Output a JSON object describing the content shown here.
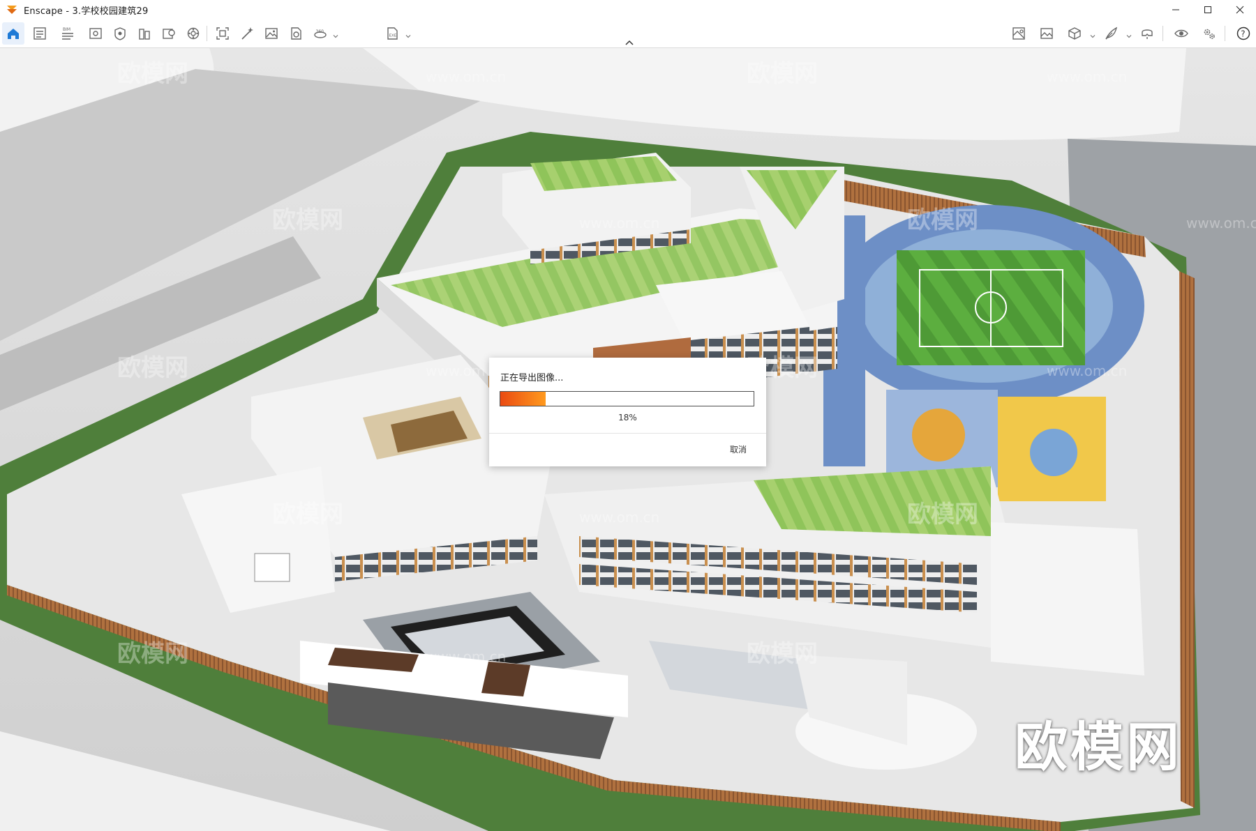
{
  "window": {
    "title": "Enscape - 3.学校校园建筑29",
    "controls": [
      "minimize-icon",
      "maximize-icon",
      "close-icon"
    ]
  },
  "toolbar": {
    "left_icons": [
      "home-icon",
      "settings-panel-icon",
      "bim-icon",
      "views-icon",
      "asset-library-icon",
      "material-editor-icon",
      "site-context-icon",
      "object-info-icon",
      "atmosphere-icon",
      "capture-view-icon",
      "magic-wand-icon",
      "screenshot-icon",
      "batch-render-icon",
      "panorama-360-icon",
      "export-exe-icon"
    ],
    "bim_label": "BIM",
    "right_icons": [
      "map-icon",
      "image-view-icon",
      "box-icon",
      "feather-icon",
      "vr-headset-icon",
      "eye-icon",
      "gears-icon",
      "help-icon"
    ],
    "help_label": "?"
  },
  "dialog": {
    "title": "正在导出图像...",
    "progress_percent": 18,
    "progress_label": "18%",
    "cancel_label": "取消"
  },
  "viewport": {
    "watermark_text": "欧模网",
    "watermark_url": "www.om.cn"
  },
  "colors": {
    "accent": "#1e7ad6",
    "progress_start": "#ea4a12",
    "progress_end": "#ff9a1e",
    "grass": "#58a33b",
    "track": "#6d8fc6",
    "wood": "#a5683e"
  }
}
